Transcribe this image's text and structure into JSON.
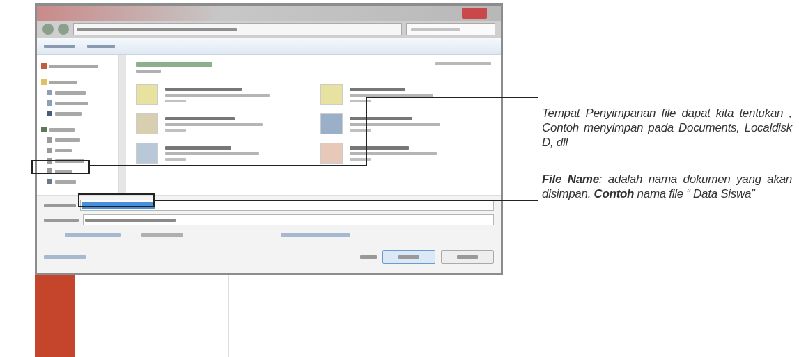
{
  "annotations": [
    {
      "text": "Tempat Penyimpanan file dapat kita tentukan , Contoh menyimpan pada Documents, Localdisk D, dll"
    },
    {
      "text": "**File Name**: adalah nama dokumen yang akan disimpan. **Contoh** nama file “ Data Siswa”"
    }
  ]
}
